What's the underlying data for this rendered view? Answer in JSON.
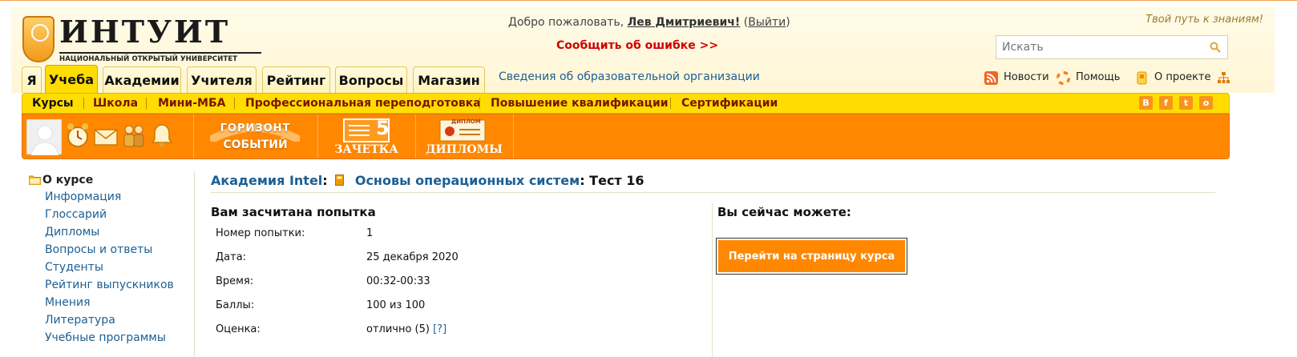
{
  "header": {
    "logo_title": "ИНТУИТ",
    "logo_subtitle": "НАЦИОНАЛЬНЫЙ ОТКРЫТЫЙ УНИВЕРСИТЕТ",
    "welcome_prefix": "Добро пожаловать,",
    "user_name": "Лев Дмитриевич!",
    "logout_label": "Выйти",
    "report_error": "Сообщить об ошибке >>",
    "slogan": "Твой путь к знаниям!",
    "search_placeholder": "Искать",
    "org_link": "Сведения об образовательной организации",
    "utility": [
      {
        "label": "Новости",
        "icon": "rss-icon"
      },
      {
        "label": "Помощь",
        "icon": "lifebuoy-icon"
      },
      {
        "label": "О проекте",
        "icon": "project-icon"
      }
    ]
  },
  "tabs": [
    {
      "label": "Я"
    },
    {
      "label": "Учеба",
      "active": true
    },
    {
      "label": "Академии"
    },
    {
      "label": "Учителя"
    },
    {
      "label": "Рейтинг"
    },
    {
      "label": "Вопросы"
    },
    {
      "label": "Магазин"
    }
  ],
  "subnav": [
    {
      "label": "Курсы",
      "active": true
    },
    {
      "label": "Школа"
    },
    {
      "label": "Мини-МБА"
    },
    {
      "label": "Профессиональная переподготовка"
    },
    {
      "label": "Повышение квалификации"
    },
    {
      "label": "Сертификации"
    }
  ],
  "social_icons": [
    "vk-icon",
    "facebook-icon",
    "twitter-icon",
    "odnoklassniki-icon"
  ],
  "orange_bar": {
    "horizon_line1": "ГОРИЗОНТ",
    "horizon_line2": "СОБЫТИЙ",
    "zachetka_label": "ЗАЧЕТКА",
    "zachetka_grade": "5",
    "diplomas_label": "ДИПЛОМЫ",
    "diploma_tag": "ДИПЛОМ"
  },
  "sidebar": {
    "title": "О курсе",
    "links": [
      "Информация",
      "Глоссарий",
      "Дипломы",
      "Вопросы и ответы",
      "Студенты",
      "Рейтинг выпускников",
      "Мнения",
      "Литература",
      "Учебные программы"
    ]
  },
  "breadcrumb": {
    "academy": "Академия Intel",
    "course": "Основы операционных систем",
    "test": "Тест 16"
  },
  "result": {
    "title": "Вам засчитана попытка",
    "rows": [
      {
        "key": "Номер попытки:",
        "value": "1"
      },
      {
        "key": "Дата:",
        "value": "25 декабря 2020"
      },
      {
        "key": "Время:",
        "value": "00:32-00:33"
      },
      {
        "key": "Баллы:",
        "value": "100 из 100"
      },
      {
        "key": "Оценка:",
        "value": "отлично (5)",
        "hint": "[?]"
      }
    ]
  },
  "actions": {
    "title": "Вы сейчас можете:",
    "go_to_course": "Перейти на страницу курса"
  },
  "colors": {
    "accent_orange": "#ff8800",
    "accent_yellow": "#ffdd00",
    "link_blue": "#1c5f94",
    "error_red": "#d00000"
  }
}
